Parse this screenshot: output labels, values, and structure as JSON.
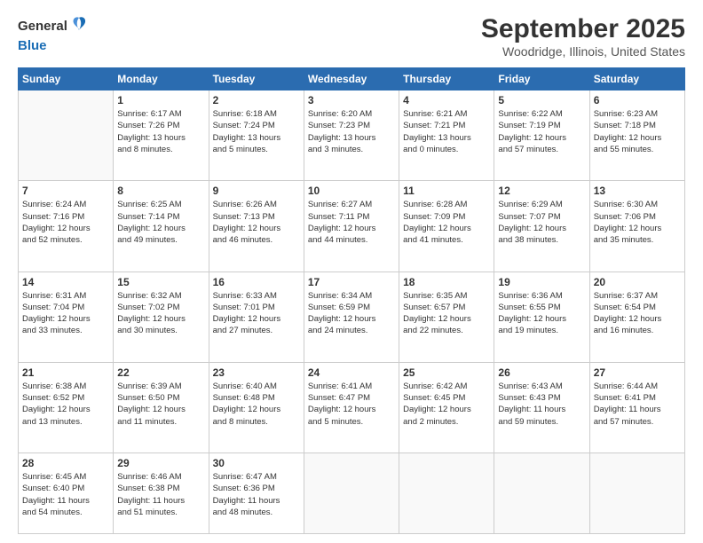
{
  "logo": {
    "general": "General",
    "blue": "Blue"
  },
  "header": {
    "month": "September 2025",
    "location": "Woodridge, Illinois, United States"
  },
  "weekdays": [
    "Sunday",
    "Monday",
    "Tuesday",
    "Wednesday",
    "Thursday",
    "Friday",
    "Saturday"
  ],
  "weeks": [
    [
      {
        "day": "",
        "info": ""
      },
      {
        "day": "1",
        "info": "Sunrise: 6:17 AM\nSunset: 7:26 PM\nDaylight: 13 hours\nand 8 minutes."
      },
      {
        "day": "2",
        "info": "Sunrise: 6:18 AM\nSunset: 7:24 PM\nDaylight: 13 hours\nand 5 minutes."
      },
      {
        "day": "3",
        "info": "Sunrise: 6:20 AM\nSunset: 7:23 PM\nDaylight: 13 hours\nand 3 minutes."
      },
      {
        "day": "4",
        "info": "Sunrise: 6:21 AM\nSunset: 7:21 PM\nDaylight: 13 hours\nand 0 minutes."
      },
      {
        "day": "5",
        "info": "Sunrise: 6:22 AM\nSunset: 7:19 PM\nDaylight: 12 hours\nand 57 minutes."
      },
      {
        "day": "6",
        "info": "Sunrise: 6:23 AM\nSunset: 7:18 PM\nDaylight: 12 hours\nand 55 minutes."
      }
    ],
    [
      {
        "day": "7",
        "info": "Sunrise: 6:24 AM\nSunset: 7:16 PM\nDaylight: 12 hours\nand 52 minutes."
      },
      {
        "day": "8",
        "info": "Sunrise: 6:25 AM\nSunset: 7:14 PM\nDaylight: 12 hours\nand 49 minutes."
      },
      {
        "day": "9",
        "info": "Sunrise: 6:26 AM\nSunset: 7:13 PM\nDaylight: 12 hours\nand 46 minutes."
      },
      {
        "day": "10",
        "info": "Sunrise: 6:27 AM\nSunset: 7:11 PM\nDaylight: 12 hours\nand 44 minutes."
      },
      {
        "day": "11",
        "info": "Sunrise: 6:28 AM\nSunset: 7:09 PM\nDaylight: 12 hours\nand 41 minutes."
      },
      {
        "day": "12",
        "info": "Sunrise: 6:29 AM\nSunset: 7:07 PM\nDaylight: 12 hours\nand 38 minutes."
      },
      {
        "day": "13",
        "info": "Sunrise: 6:30 AM\nSunset: 7:06 PM\nDaylight: 12 hours\nand 35 minutes."
      }
    ],
    [
      {
        "day": "14",
        "info": "Sunrise: 6:31 AM\nSunset: 7:04 PM\nDaylight: 12 hours\nand 33 minutes."
      },
      {
        "day": "15",
        "info": "Sunrise: 6:32 AM\nSunset: 7:02 PM\nDaylight: 12 hours\nand 30 minutes."
      },
      {
        "day": "16",
        "info": "Sunrise: 6:33 AM\nSunset: 7:01 PM\nDaylight: 12 hours\nand 27 minutes."
      },
      {
        "day": "17",
        "info": "Sunrise: 6:34 AM\nSunset: 6:59 PM\nDaylight: 12 hours\nand 24 minutes."
      },
      {
        "day": "18",
        "info": "Sunrise: 6:35 AM\nSunset: 6:57 PM\nDaylight: 12 hours\nand 22 minutes."
      },
      {
        "day": "19",
        "info": "Sunrise: 6:36 AM\nSunset: 6:55 PM\nDaylight: 12 hours\nand 19 minutes."
      },
      {
        "day": "20",
        "info": "Sunrise: 6:37 AM\nSunset: 6:54 PM\nDaylight: 12 hours\nand 16 minutes."
      }
    ],
    [
      {
        "day": "21",
        "info": "Sunrise: 6:38 AM\nSunset: 6:52 PM\nDaylight: 12 hours\nand 13 minutes."
      },
      {
        "day": "22",
        "info": "Sunrise: 6:39 AM\nSunset: 6:50 PM\nDaylight: 12 hours\nand 11 minutes."
      },
      {
        "day": "23",
        "info": "Sunrise: 6:40 AM\nSunset: 6:48 PM\nDaylight: 12 hours\nand 8 minutes."
      },
      {
        "day": "24",
        "info": "Sunrise: 6:41 AM\nSunset: 6:47 PM\nDaylight: 12 hours\nand 5 minutes."
      },
      {
        "day": "25",
        "info": "Sunrise: 6:42 AM\nSunset: 6:45 PM\nDaylight: 12 hours\nand 2 minutes."
      },
      {
        "day": "26",
        "info": "Sunrise: 6:43 AM\nSunset: 6:43 PM\nDaylight: 11 hours\nand 59 minutes."
      },
      {
        "day": "27",
        "info": "Sunrise: 6:44 AM\nSunset: 6:41 PM\nDaylight: 11 hours\nand 57 minutes."
      }
    ],
    [
      {
        "day": "28",
        "info": "Sunrise: 6:45 AM\nSunset: 6:40 PM\nDaylight: 11 hours\nand 54 minutes."
      },
      {
        "day": "29",
        "info": "Sunrise: 6:46 AM\nSunset: 6:38 PM\nDaylight: 11 hours\nand 51 minutes."
      },
      {
        "day": "30",
        "info": "Sunrise: 6:47 AM\nSunset: 6:36 PM\nDaylight: 11 hours\nand 48 minutes."
      },
      {
        "day": "",
        "info": ""
      },
      {
        "day": "",
        "info": ""
      },
      {
        "day": "",
        "info": ""
      },
      {
        "day": "",
        "info": ""
      }
    ]
  ]
}
